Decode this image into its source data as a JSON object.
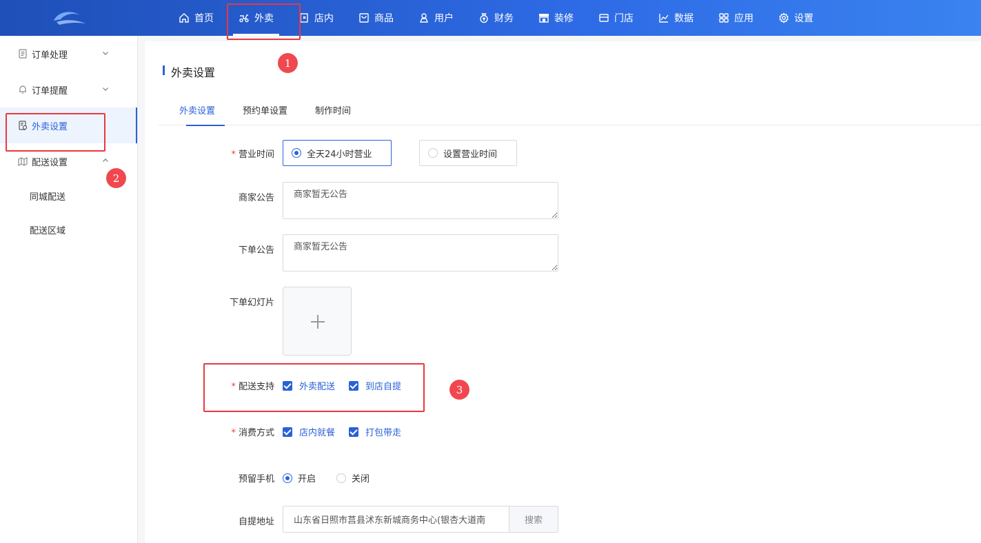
{
  "nav": {
    "items": [
      {
        "label": "首页",
        "icon": "home-icon"
      },
      {
        "label": "外卖",
        "icon": "scooter-icon",
        "active": true
      },
      {
        "label": "店内",
        "icon": "store-door-icon"
      },
      {
        "label": "商品",
        "icon": "shopping-bag-icon"
      },
      {
        "label": "用户",
        "icon": "user-icon"
      },
      {
        "label": "财务",
        "icon": "money-bag-icon"
      },
      {
        "label": "装修",
        "icon": "shop-front-icon"
      },
      {
        "label": "门店",
        "icon": "store-icon"
      },
      {
        "label": "数据",
        "icon": "chart-icon"
      },
      {
        "label": "应用",
        "icon": "apps-grid-icon"
      },
      {
        "label": "设置",
        "icon": "gear-icon"
      }
    ]
  },
  "sidebar": {
    "items": [
      {
        "label": "订单处理",
        "icon": "document-icon",
        "arrow": "down"
      },
      {
        "label": "订单提醒",
        "icon": "bell-icon",
        "arrow": "down"
      },
      {
        "label": "外卖设置",
        "icon": "settings-doc-icon",
        "active": true
      },
      {
        "label": "配送设置",
        "icon": "map-icon",
        "arrow": "up"
      }
    ],
    "sub_items": [
      "同城配送",
      "配送区域"
    ]
  },
  "page": {
    "title": "外卖设置",
    "tabs": [
      "外卖设置",
      "预约单设置",
      "制作时间"
    ]
  },
  "form": {
    "business_hours": {
      "label": "营业时间",
      "options": [
        "全天24小时营业",
        "设置营业时间"
      ],
      "selected": 0
    },
    "merchant_notice": {
      "label": "商家公告",
      "value": "商家暂无公告"
    },
    "order_notice": {
      "label": "下单公告",
      "value": "商家暂无公告"
    },
    "slideshow": {
      "label": "下单幻灯片"
    },
    "delivery_support": {
      "label": "配送支持",
      "options": [
        "外卖配送",
        "到店自提"
      ]
    },
    "consume_mode": {
      "label": "消费方式",
      "options": [
        "店内就餐",
        "打包带走"
      ]
    },
    "reserve_phone": {
      "label": "预留手机",
      "options": [
        "开启",
        "关闭"
      ],
      "selected": 0
    },
    "pickup_address": {
      "label": "自提地址",
      "value": "山东省日照市莒县沭东新城商务中心(银杏大道南",
      "button": "搜索"
    }
  },
  "annotations": [
    "1",
    "2",
    "3"
  ],
  "colors": {
    "primary": "#2a62d6",
    "highlight": "#e8383d"
  }
}
